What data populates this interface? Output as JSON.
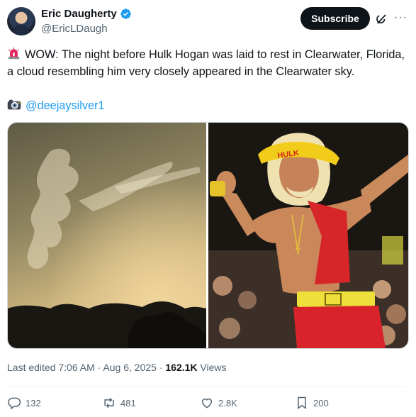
{
  "author": {
    "display_name": "Eric Daugherty",
    "handle": "@EricLDaugh"
  },
  "header": {
    "subscribe_label": "Subscribe",
    "more_label": "···"
  },
  "tweet": {
    "text": "WOW: The night before Hulk Hogan was laid to rest in Clearwater, Florida, a cloud resembling him very closely appeared in the Clearwater sky.",
    "credit_mention": "@deejaysilver1"
  },
  "meta": {
    "edited": "Last edited 7:06 AM · Aug 6, 2025 · ",
    "views_count": "162.1K",
    "views_label": " Views"
  },
  "actions": {
    "replies": "132",
    "reposts": "481",
    "likes": "2.8K",
    "bookmarks": "200"
  },
  "colors": {
    "accent": "#1d9bf0",
    "text": "#0f1419",
    "muted": "#536471",
    "verified": "#1d9bf0",
    "siren": "#e0245e"
  },
  "icons": [
    "verified-badge-icon",
    "grok-icon",
    "more-icon",
    "siren-icon",
    "camera-icon",
    "reply-icon",
    "repost-icon",
    "like-icon",
    "bookmark-icon"
  ]
}
